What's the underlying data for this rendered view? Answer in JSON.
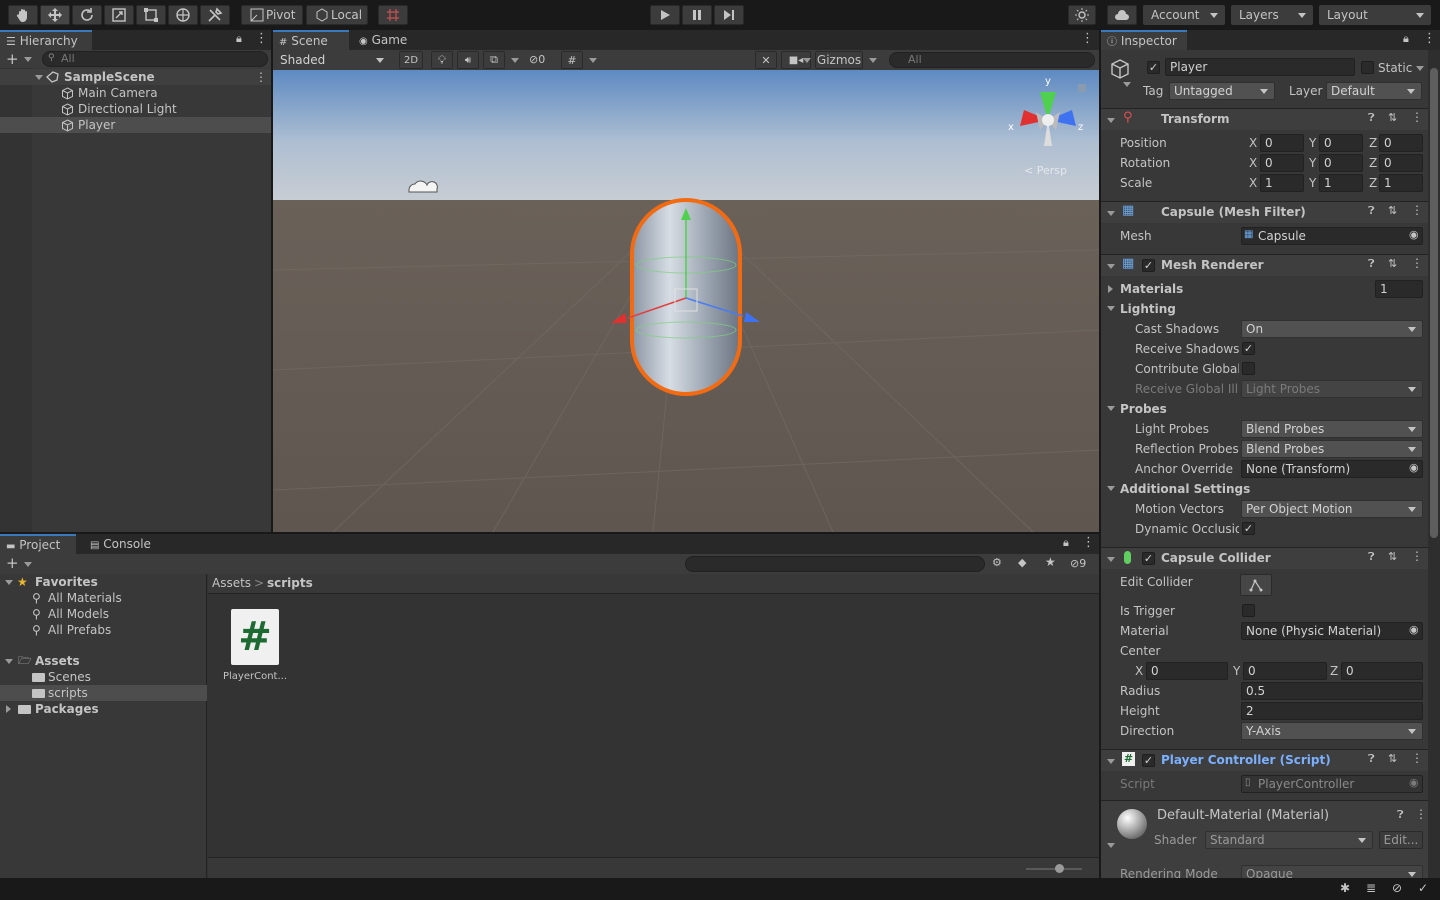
{
  "toolbar": {
    "pivot_label": "Pivot",
    "local_label": "Local",
    "account_label": "Account",
    "layers_label": "Layers",
    "layout_label": "Layout"
  },
  "hierarchy": {
    "tab_label": "Hierarchy",
    "search_placeholder": "All",
    "scene_name": "SampleScene",
    "items": [
      "Main Camera",
      "Directional Light",
      "Player"
    ]
  },
  "scene": {
    "tab_scene": "Scene",
    "tab_game": "Game",
    "shading_mode": "Shaded",
    "btn_2d": "2D",
    "hidden_count": "0",
    "gizmos_label": "Gizmos",
    "search_placeholder": "All",
    "persp_label": "< Persp",
    "axis_x": "x",
    "axis_y": "y",
    "axis_z": "z"
  },
  "project": {
    "tab_project": "Project",
    "tab_console": "Console",
    "favorites_label": "Favorites",
    "favorites": [
      "All Materials",
      "All Models",
      "All Prefabs"
    ],
    "assets_label": "Assets",
    "asset_folders": [
      "Scenes",
      "scripts"
    ],
    "packages_label": "Packages",
    "breadcrumb_root": "Assets",
    "breadcrumb_sep": ">",
    "breadcrumb_current": "scripts",
    "file_name": "PlayerCont...",
    "hidden_count": "9"
  },
  "inspector": {
    "tab_label": "Inspector",
    "object_name": "Player",
    "static_label": "Static",
    "tag_label": "Tag",
    "tag_value": "Untagged",
    "layer_label": "Layer",
    "layer_value": "Default",
    "transform": {
      "title": "Transform",
      "position_label": "Position",
      "rotation_label": "Rotation",
      "scale_label": "Scale",
      "position": [
        "0",
        "0",
        "0"
      ],
      "rotation": [
        "0",
        "0",
        "0"
      ],
      "scale": [
        "1",
        "1",
        "1"
      ]
    },
    "axis": [
      "X",
      "Y",
      "Z"
    ],
    "mesh_filter": {
      "title": "Capsule (Mesh Filter)",
      "mesh_label": "Mesh",
      "mesh_value": "Capsule"
    },
    "mesh_renderer": {
      "title": "Mesh Renderer",
      "materials_label": "Materials",
      "materials_count": "1",
      "lighting_label": "Lighting",
      "cast_shadows_label": "Cast Shadows",
      "cast_shadows_value": "On",
      "receive_shadows_label": "Receive Shadows",
      "contribute_gi_label": "Contribute Global I",
      "receive_gi_label": "Receive Global Illu",
      "receive_gi_value": "Light Probes",
      "probes_label": "Probes",
      "light_probes_label": "Light Probes",
      "light_probes_value": "Blend Probes",
      "reflection_probes_label": "Reflection Probes",
      "reflection_probes_value": "Blend Probes",
      "anchor_override_label": "Anchor Override",
      "anchor_override_value": "None (Transform)",
      "additional_label": "Additional Settings",
      "motion_vectors_label": "Motion Vectors",
      "motion_vectors_value": "Per Object Motion",
      "dynamic_occlusion_label": "Dynamic Occlusio"
    },
    "capsule_collider": {
      "title": "Capsule Collider",
      "edit_collider_label": "Edit Collider",
      "is_trigger_label": "Is Trigger",
      "material_label": "Material",
      "material_value": "None (Physic Material)",
      "center_label": "Center",
      "center": [
        "0",
        "0",
        "0"
      ],
      "radius_label": "Radius",
      "radius_value": "0.5",
      "height_label": "Height",
      "height_value": "2",
      "direction_label": "Direction",
      "direction_value": "Y-Axis"
    },
    "player_controller": {
      "title": "Player Controller (Script)",
      "script_label": "Script",
      "script_value": "PlayerController"
    },
    "material": {
      "title": "Default-Material (Material)",
      "shader_label": "Shader",
      "shader_value": "Standard",
      "edit_label": "Edit...",
      "rendering_mode_label": "Rendering Mode",
      "rendering_mode_value": "Opaque"
    }
  },
  "colors": {
    "accent": "#3a79bb",
    "selection_outline": "#f26b13",
    "link_blue": "#7bb0ff"
  }
}
